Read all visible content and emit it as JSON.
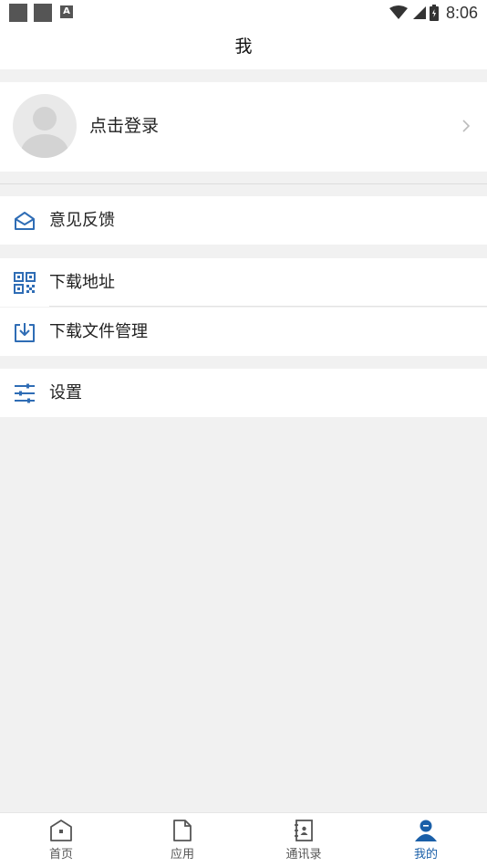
{
  "status_bar": {
    "time": "8:06",
    "notification_icon_letter": "A"
  },
  "header": {
    "title": "我"
  },
  "profile": {
    "login_label": "点击登录"
  },
  "menu": {
    "feedback": {
      "label": "意见反馈",
      "icon": "mail-open-icon"
    },
    "download_address": {
      "label": "下载地址",
      "icon": "qr-code-icon"
    },
    "download_manager": {
      "label": "下载文件管理",
      "icon": "download-box-icon"
    },
    "settings": {
      "label": "设置",
      "icon": "sliders-icon"
    }
  },
  "bottom_nav": {
    "items": [
      {
        "label": "首页",
        "icon": "home-icon",
        "active": false
      },
      {
        "label": "应用",
        "icon": "document-icon",
        "active": false
      },
      {
        "label": "通讯录",
        "icon": "contacts-book-icon",
        "active": false
      },
      {
        "label": "我的",
        "icon": "person-icon",
        "active": true
      }
    ]
  },
  "colors": {
    "accent": "#1a5fa8",
    "icon_blue": "#2f6db5",
    "background": "#f1f1f1"
  }
}
